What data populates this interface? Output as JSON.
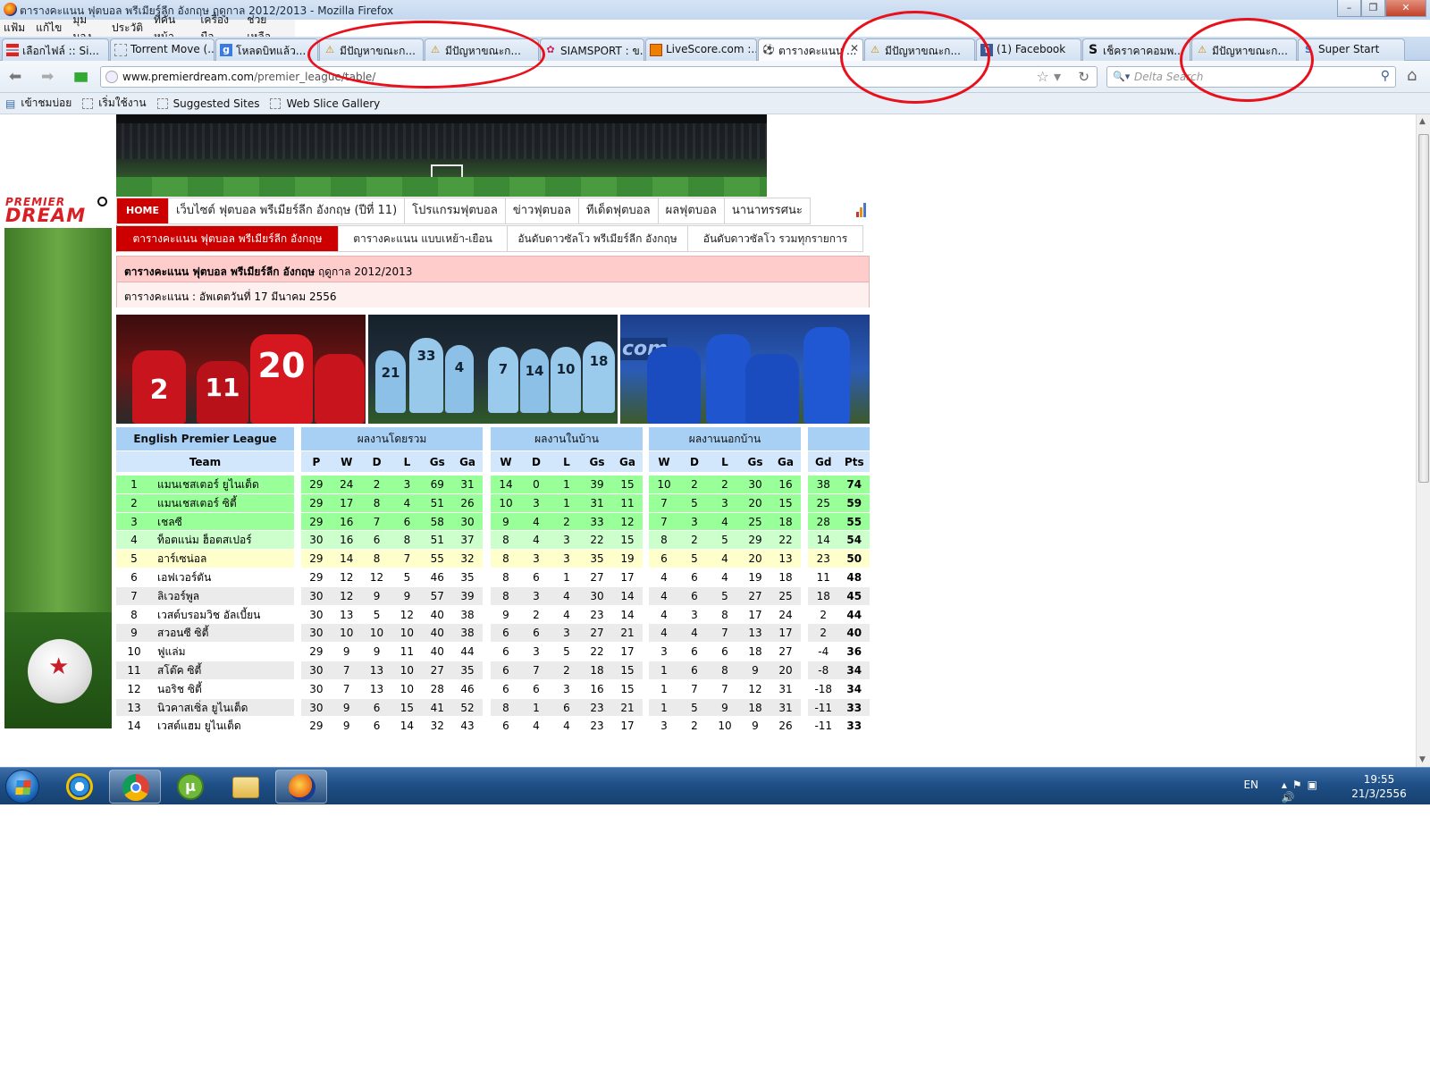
{
  "window": {
    "title": "ตารางคะแนน ฟุตบอล พรีเมียร์ลีก อังกฤษ ฤดูกาล 2012/2013 - Mozilla Firefox"
  },
  "menu": [
    "แฟ้ม",
    "แก้ไข",
    "มุมมอง",
    "ประวัติ",
    "ที่คั่นหน้า",
    "เครื่องมือ",
    "ช่วยเหลือ"
  ],
  "tabs": [
    {
      "label": "เลือกไฟล์ :: Si...",
      "icon": "thai-flag-icon"
    },
    {
      "label": "Torrent Move (...",
      "icon": "blank-page-icon"
    },
    {
      "label": "โหลดบิทแล้ว...",
      "icon": "google-icon"
    },
    {
      "label": "มีปัญหาขณะก...",
      "icon": "warning-icon"
    },
    {
      "label": "มีปัญหาขณะก...",
      "icon": "warning-icon"
    },
    {
      "label": "SIAMSPORT : ข...",
      "icon": "siamsport-icon"
    },
    {
      "label": "LiveScore.com :...",
      "icon": "livescore-icon"
    },
    {
      "label": "ตารางคะแนน ...",
      "icon": "soccer-ball-icon"
    },
    {
      "label": "มีปัญหาขณะก...",
      "icon": "warning-icon"
    },
    {
      "label": "(1) Facebook",
      "icon": "facebook-icon"
    },
    {
      "label": "เช็คราคาคอมพ...",
      "icon": "s-logo-icon"
    },
    {
      "label": "มีปัญหาขณะก...",
      "icon": "warning-icon"
    },
    {
      "label": "Super Start",
      "icon": "super-start-icon"
    }
  ],
  "nav": {
    "url_host": "www.premierdream.com",
    "url_path": "/premier_league/table/",
    "search_placeholder": "Delta Search"
  },
  "bookmarks": [
    "เข้าชมบ่อย",
    "เริ่มใช้งาน",
    "Suggested Sites",
    "Web Slice Gallery"
  ],
  "site": {
    "logo_line1": "PREMIER",
    "logo_line2": "DREAM",
    "nav1": [
      "HOME",
      "เว็บไซต์ ฟุตบอล พรีเมียร์ลีก อังกฤษ (ปีที่ 11)",
      "โปรแกรมฟุตบอล",
      "ข่าวฟุตบอล",
      "ทีเด็ดฟุตบอล",
      "ผลฟุตบอล",
      "นานาทรรศนะ"
    ],
    "nav2": [
      "ตารางคะแนน ฟุตบอล พรีเมียร์ลีก อังกฤษ",
      "ตารางคะแนน แบบเหย้า-เยือน",
      "อันดับดาวซัลโว พรีเมียร์ลีก อังกฤษ",
      "อันดับดาวซัลโว รวมทุกรายการ"
    ],
    "heading_bold": "ตารางคะแนน ฟุตบอล พรีเมียร์ลีก อังกฤษ",
    "heading_season": "ฤดูกาล 2012/2013",
    "updated": "ตารางคะแนน : อัพเดตวันที่ 17 มีนาคม 2556"
  },
  "photos": {
    "p1_numbers": [
      "2",
      "20",
      "11"
    ],
    "p2_numbers": [
      "21",
      "33",
      "4",
      "7",
      "14",
      "10",
      "18"
    ],
    "p3_text": "com"
  },
  "table": {
    "league": "English Premier League",
    "team_header": "Team",
    "group_overall": "ผลงานโดยรวม",
    "group_home": "ผลงานในบ้าน",
    "group_away": "ผลงานนอกบ้าน",
    "cols_overall": [
      "P",
      "W",
      "D",
      "L",
      "Gs",
      "Ga"
    ],
    "cols_side": [
      "W",
      "D",
      "L",
      "Gs",
      "Ga"
    ],
    "cols_end": [
      "Gd",
      "Pts"
    ],
    "rows": [
      {
        "pos": "1",
        "team": "แมนเชสเตอร์ ยูไนเต็ด",
        "zone": "g",
        "overall": [
          "29",
          "24",
          "2",
          "3",
          "69",
          "31"
        ],
        "home": [
          "14",
          "0",
          "1",
          "39",
          "15"
        ],
        "away": [
          "10",
          "2",
          "2",
          "30",
          "16"
        ],
        "gd": "38",
        "pts": "74"
      },
      {
        "pos": "2",
        "team": "แมนเชสเตอร์ ซิตี้",
        "zone": "g",
        "overall": [
          "29",
          "17",
          "8",
          "4",
          "51",
          "26"
        ],
        "home": [
          "10",
          "3",
          "1",
          "31",
          "11"
        ],
        "away": [
          "7",
          "5",
          "3",
          "20",
          "15"
        ],
        "gd": "25",
        "pts": "59"
      },
      {
        "pos": "3",
        "team": "เชลซี",
        "zone": "g",
        "overall": [
          "29",
          "16",
          "7",
          "6",
          "58",
          "30"
        ],
        "home": [
          "9",
          "4",
          "2",
          "33",
          "12"
        ],
        "away": [
          "7",
          "3",
          "4",
          "25",
          "18"
        ],
        "gd": "28",
        "pts": "55"
      },
      {
        "pos": "4",
        "team": "ท็อตแน่ม ฮ็อตสเปอร์",
        "zone": "lg",
        "overall": [
          "30",
          "16",
          "6",
          "8",
          "51",
          "37"
        ],
        "home": [
          "8",
          "4",
          "3",
          "22",
          "15"
        ],
        "away": [
          "8",
          "2",
          "5",
          "29",
          "22"
        ],
        "gd": "14",
        "pts": "54"
      },
      {
        "pos": "5",
        "team": "อาร์เซน่อล",
        "zone": "y",
        "overall": [
          "29",
          "14",
          "8",
          "7",
          "55",
          "32"
        ],
        "home": [
          "8",
          "3",
          "3",
          "35",
          "19"
        ],
        "away": [
          "6",
          "5",
          "4",
          "20",
          "13"
        ],
        "gd": "23",
        "pts": "50"
      },
      {
        "pos": "6",
        "team": "เอฟเวอร์ตัน",
        "zone": "w",
        "overall": [
          "29",
          "12",
          "12",
          "5",
          "46",
          "35"
        ],
        "home": [
          "8",
          "6",
          "1",
          "27",
          "17"
        ],
        "away": [
          "4",
          "6",
          "4",
          "19",
          "18"
        ],
        "gd": "11",
        "pts": "48"
      },
      {
        "pos": "7",
        "team": "ลิเวอร์พูล",
        "zone": "gr",
        "overall": [
          "30",
          "12",
          "9",
          "9",
          "57",
          "39"
        ],
        "home": [
          "8",
          "3",
          "4",
          "30",
          "14"
        ],
        "away": [
          "4",
          "6",
          "5",
          "27",
          "25"
        ],
        "gd": "18",
        "pts": "45"
      },
      {
        "pos": "8",
        "team": "เวสต์บรอมวิช อัลเบี้ยน",
        "zone": "w",
        "overall": [
          "30",
          "13",
          "5",
          "12",
          "40",
          "38"
        ],
        "home": [
          "9",
          "2",
          "4",
          "23",
          "14"
        ],
        "away": [
          "4",
          "3",
          "8",
          "17",
          "24"
        ],
        "gd": "2",
        "pts": "44"
      },
      {
        "pos": "9",
        "team": "สวอนซี ซิตี้",
        "zone": "gr",
        "overall": [
          "30",
          "10",
          "10",
          "10",
          "40",
          "38"
        ],
        "home": [
          "6",
          "6",
          "3",
          "27",
          "21"
        ],
        "away": [
          "4",
          "4",
          "7",
          "13",
          "17"
        ],
        "gd": "2",
        "pts": "40"
      },
      {
        "pos": "10",
        "team": "ฟูแล่ม",
        "zone": "w",
        "overall": [
          "29",
          "9",
          "9",
          "11",
          "40",
          "44"
        ],
        "home": [
          "6",
          "3",
          "5",
          "22",
          "17"
        ],
        "away": [
          "3",
          "6",
          "6",
          "18",
          "27"
        ],
        "gd": "-4",
        "pts": "36"
      },
      {
        "pos": "11",
        "team": "สโต๊ค ซิตี้",
        "zone": "gr",
        "overall": [
          "30",
          "7",
          "13",
          "10",
          "27",
          "35"
        ],
        "home": [
          "6",
          "7",
          "2",
          "18",
          "15"
        ],
        "away": [
          "1",
          "6",
          "8",
          "9",
          "20"
        ],
        "gd": "-8",
        "pts": "34"
      },
      {
        "pos": "12",
        "team": "นอริช ซิตี้",
        "zone": "w",
        "overall": [
          "30",
          "7",
          "13",
          "10",
          "28",
          "46"
        ],
        "home": [
          "6",
          "6",
          "3",
          "16",
          "15"
        ],
        "away": [
          "1",
          "7",
          "7",
          "12",
          "31"
        ],
        "gd": "-18",
        "pts": "34"
      },
      {
        "pos": "13",
        "team": "นิวคาสเซิ่ล ยูไนเต็ด",
        "zone": "gr",
        "overall": [
          "30",
          "9",
          "6",
          "15",
          "41",
          "52"
        ],
        "home": [
          "8",
          "1",
          "6",
          "23",
          "21"
        ],
        "away": [
          "1",
          "5",
          "9",
          "18",
          "31"
        ],
        "gd": "-11",
        "pts": "33"
      },
      {
        "pos": "14",
        "team": "เวสต์แฮม ยูไนเต็ด",
        "zone": "w",
        "overall": [
          "29",
          "9",
          "6",
          "14",
          "32",
          "43"
        ],
        "home": [
          "6",
          "4",
          "4",
          "23",
          "17"
        ],
        "away": [
          "3",
          "2",
          "10",
          "9",
          "26"
        ],
        "gd": "-11",
        "pts": "33"
      }
    ]
  },
  "taskbar": {
    "apps": [
      "internet-explorer-icon",
      "chrome-icon",
      "utorrent-icon",
      "folder-icon",
      "firefox-icon"
    ],
    "lang": "EN",
    "time": "19:55",
    "date": "21/3/2556"
  },
  "colors": {
    "nav_red": "#cc0000",
    "header_blue": "#a8d0f5",
    "champions_green": "#99ff99",
    "europa_lightgreen": "#ccffcc",
    "yellow": "#ffffcc",
    "annotation_red": "#e8101a"
  }
}
